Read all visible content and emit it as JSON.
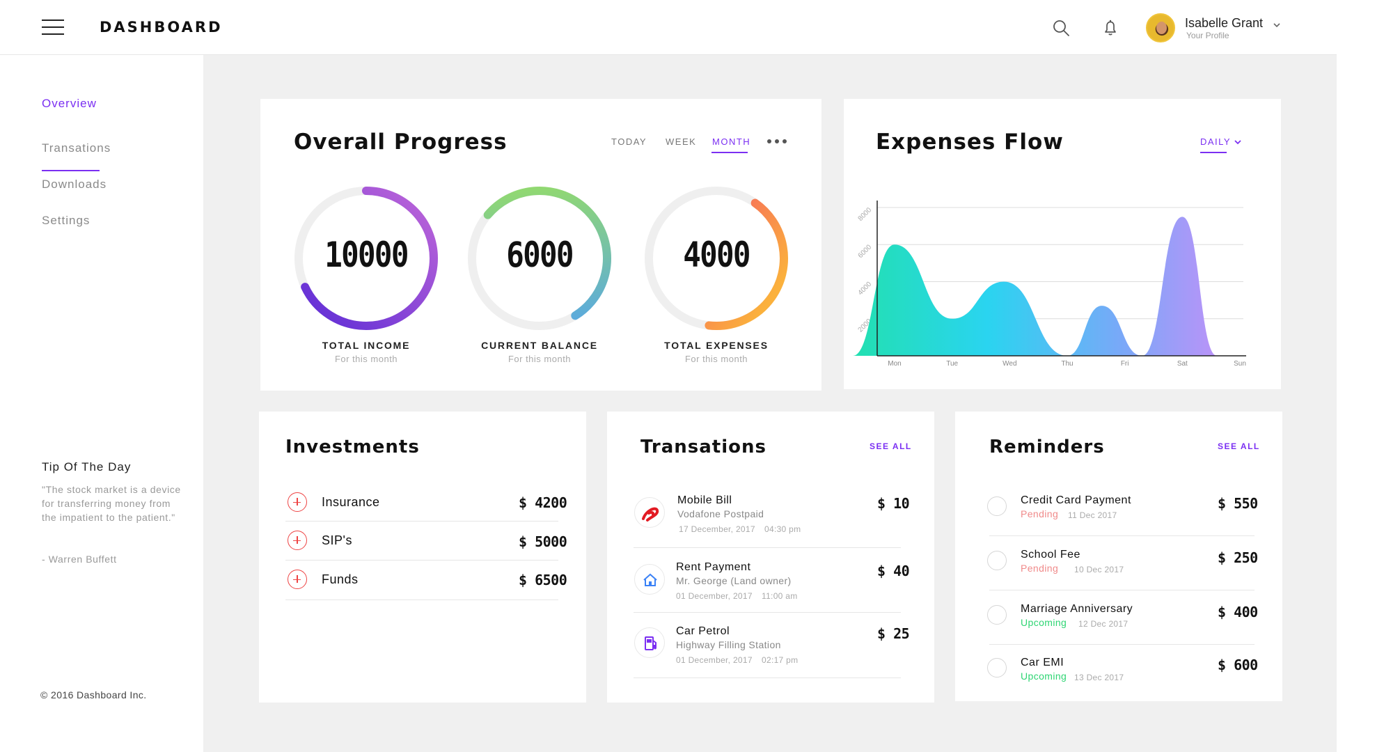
{
  "header": {
    "brand": "DASHBOARD",
    "user_name": "Isabelle Grant",
    "user_sub": "Your Profile",
    "icons": [
      "menu-icon",
      "search-icon",
      "bell-icon",
      "chevron-down-icon"
    ]
  },
  "sidebar": {
    "items": [
      {
        "label": "Overview",
        "active": true
      },
      {
        "label": "Transations",
        "active": false
      },
      {
        "label": "Downloads",
        "active": false
      },
      {
        "label": "Settings",
        "active": false
      }
    ],
    "tip_title": "Tip Of The Day",
    "tip_text": "\"The stock market is a device for transferring money from the impatient to the patient.\"",
    "tip_author": "- Warren Buffett",
    "copyright": "© 2016 Dashboard Inc."
  },
  "progress": {
    "title": "Overall Progress",
    "tabs": [
      "TODAY",
      "WEEK",
      "MONTH"
    ],
    "active_tab": "MONTH",
    "rings": [
      {
        "value": "10000",
        "label": "TOTAL INCOME",
        "sub": "For this month",
        "fill": 0.68,
        "colors": [
          "#5b2bd6",
          "#b35ad8"
        ]
      },
      {
        "value": "6000",
        "label": "CURRENT BALANCE",
        "sub": "For this month",
        "fill": 0.55,
        "colors": [
          "#4fa0f5",
          "#9be15d"
        ]
      },
      {
        "value": "4000",
        "label": "TOTAL EXPENSES",
        "sub": "For this month",
        "fill": 0.42,
        "colors": [
          "#f44b6a",
          "#fbb13c"
        ]
      }
    ]
  },
  "expenses": {
    "title": "Expenses Flow",
    "period": "DAILY"
  },
  "chart_data": {
    "type": "area",
    "categories": [
      "Mon",
      "Tue",
      "Wed",
      "Thu",
      "Fri",
      "Sat",
      "Sun"
    ],
    "x_points": [
      0,
      1,
      1.9,
      3,
      3.6,
      4.3,
      5,
      5.6,
      6.3
    ],
    "values": [
      6000,
      2000,
      4000,
      0,
      2700,
      0,
      7500,
      0,
      0
    ],
    "yticks": [
      "2000",
      "4000",
      "6000",
      "8000"
    ],
    "ylim": [
      0,
      8000
    ],
    "grid": true,
    "legend": "none",
    "colors": [
      "#22e0b0",
      "#2ad4f0",
      "#7aa8f8",
      "#d58af8"
    ]
  },
  "investments": {
    "title": "Investments",
    "items": [
      {
        "name": "Insurance",
        "amount": "$ 4200"
      },
      {
        "name": "SIP's",
        "amount": "$ 5000"
      },
      {
        "name": "Funds",
        "amount": "$ 6500"
      }
    ]
  },
  "transactions": {
    "title": "Transations",
    "see_all": "SEE ALL",
    "items": [
      {
        "name": "Mobile Bill",
        "sub": "Vodafone Postpaid",
        "date": "17 December, 2017",
        "time": "04:30 pm",
        "amount": "$ 10",
        "icon": "airtel-logo-icon"
      },
      {
        "name": "Rent Payment",
        "sub": "Mr. George (Land owner)",
        "date": "01 December, 2017",
        "time": "11:00 am",
        "amount": "$ 40",
        "icon": "house-icon"
      },
      {
        "name": "Car Petrol",
        "sub": "Highway Filling Station",
        "date": "01 December, 2017",
        "time": "02:17 pm",
        "amount": "$ 25",
        "icon": "fuel-pump-icon"
      }
    ]
  },
  "reminders": {
    "title": "Reminders",
    "see_all": "SEE ALL",
    "items": [
      {
        "name": "Credit Card Payment",
        "status": "Pending",
        "date": "11 Dec 2017",
        "amount": "$ 550"
      },
      {
        "name": "School Fee",
        "status": "Pending",
        "date": "10 Dec 2017",
        "amount": "$ 250"
      },
      {
        "name": "Marriage Anniversary",
        "status": "Upcoming",
        "date": "12 Dec 2017",
        "amount": "$ 400"
      },
      {
        "name": "Car EMI",
        "status": "Upcoming",
        "date": "13 Dec 2017",
        "amount": "$ 600"
      }
    ]
  },
  "colors": {
    "accent": "#7b2ff2",
    "pending": "#f08a8a",
    "upcoming": "#2ed573",
    "plus": "#ee4444"
  }
}
